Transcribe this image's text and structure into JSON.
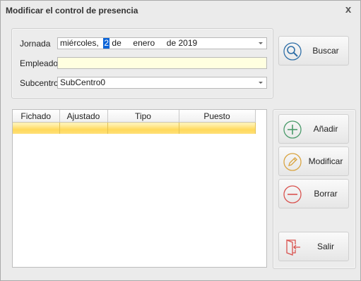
{
  "window": {
    "title": "Modificar el control de presencia",
    "close_glyph": "x"
  },
  "form": {
    "jornada_label": "Jornada",
    "jornada_date": {
      "weekday": "miércoles,",
      "day": "2",
      "de1": "de",
      "month": "enero",
      "de2": "de",
      "year": "2019"
    },
    "empleado_label": "Empleado",
    "empleado_value": "",
    "subcentro_label": "Subcentro",
    "subcentro_value": "SubCentro0"
  },
  "buttons": {
    "buscar": "Buscar",
    "anadir": "Añadir",
    "modificar": "Modificar",
    "borrar": "Borrar",
    "salir": "Salir"
  },
  "grid": {
    "columns": [
      "Fichado",
      "Ajustado",
      "Tipo",
      "Puesto"
    ],
    "rows": [
      [
        "",
        "",
        "",
        ""
      ]
    ]
  },
  "colors": {
    "selected_row": "#ffd95c",
    "add_icon": "#4a9a6a",
    "edit_icon": "#d9a441",
    "delete_icon": "#d9534f",
    "exit_icon": "#d9534f",
    "search_icon": "#2f6fa7"
  },
  "icons": {
    "search": "magnifier-icon",
    "add": "plus-circle-icon",
    "edit": "pencil-circle-icon",
    "delete": "minus-circle-icon",
    "exit": "exit-door-icon"
  }
}
